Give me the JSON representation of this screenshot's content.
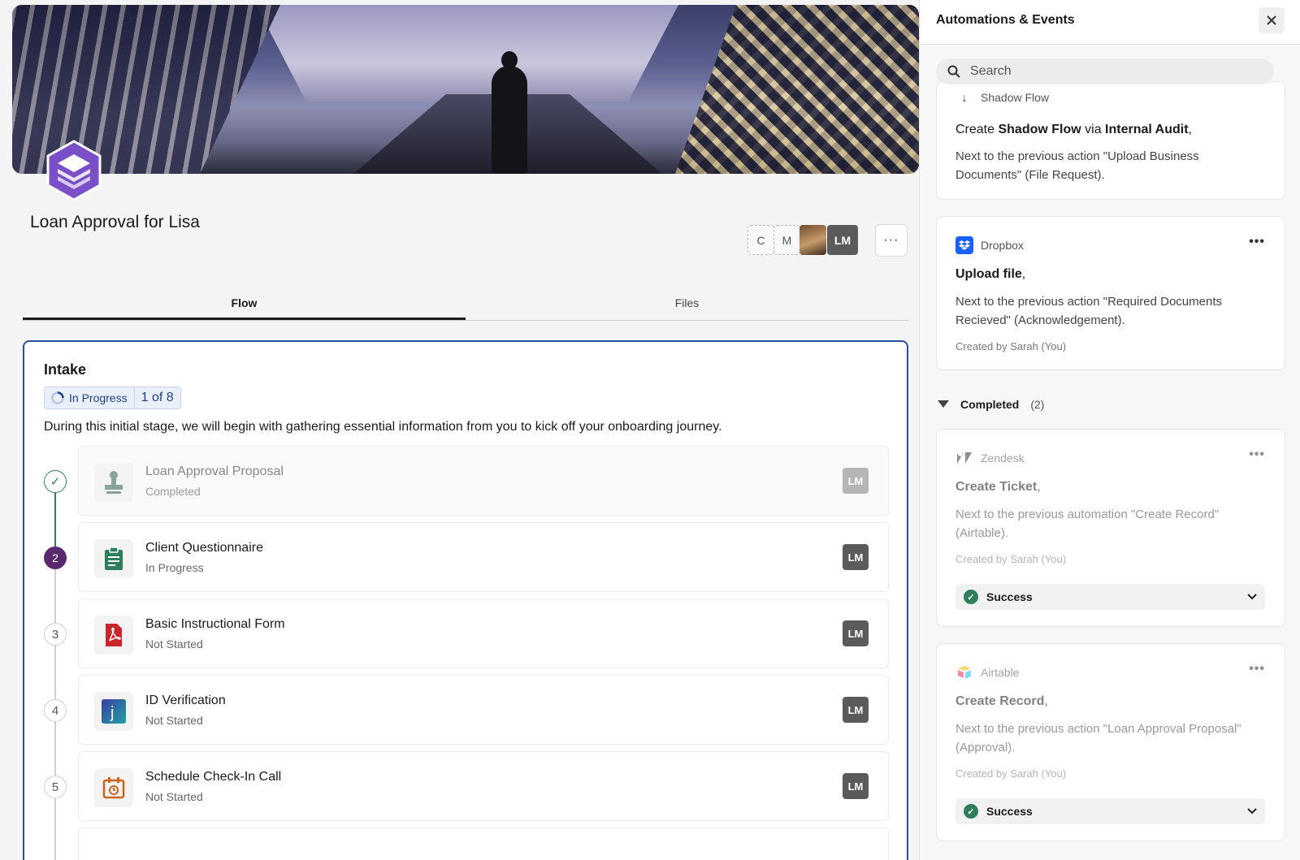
{
  "page": {
    "title": "Loan Approval for Lisa"
  },
  "assignees": [
    "C",
    "M",
    "LM"
  ],
  "header_more": "···",
  "tabs": [
    {
      "label": "Flow",
      "active": true
    },
    {
      "label": "Files",
      "active": false
    }
  ],
  "stage": {
    "title": "Intake",
    "status": "In Progress",
    "count": "1 of 8",
    "description": "During this initial stage, we will begin with gathering essential information from you to kick off your onboarding journey."
  },
  "steps": [
    {
      "marker": "✓",
      "name": "Loan Approval Proposal",
      "status": "Completed",
      "owner": "LM",
      "icon": "stamp-icon"
    },
    {
      "marker": "2",
      "name": "Client Questionnaire",
      "status": "In Progress",
      "owner": "LM",
      "icon": "clipboard-icon"
    },
    {
      "marker": "3",
      "name": "Basic Instructional Form",
      "status": "Not Started",
      "owner": "LM",
      "icon": "pdf-icon"
    },
    {
      "marker": "4",
      "name": "ID Verification",
      "status": "Not Started",
      "owner": "LM",
      "icon": "jumio-icon"
    },
    {
      "marker": "5",
      "name": "Schedule Check-In Call",
      "status": "Not Started",
      "owner": "LM",
      "icon": "calendar-icon"
    }
  ],
  "panel": {
    "title": "Automations & Events",
    "search_placeholder": "Search",
    "partial_card": {
      "app": "Shadow Flow",
      "action_prefix": "Create ",
      "action_bold1": "Shadow Flow",
      "action_mid": " via ",
      "action_bold2": "Internal Audit",
      "action_suffix": ",",
      "desc": "Next to the previous action \"Upload Business Documents\" (File Request)."
    },
    "pending_card": {
      "app": "Dropbox",
      "action": "Upload file",
      "action_suffix": ",",
      "desc": "Next to the previous action \"Required Documents Recieved\" (Acknowledgement).",
      "created": "Created by Sarah (You)"
    },
    "completed_label": "Completed",
    "completed_count": "(2)",
    "completed_cards": [
      {
        "app": "Zendesk",
        "action": "Create Ticket",
        "action_suffix": ",",
        "desc": "Next to the previous automation \"Create Record\" (Airtable).",
        "created": "Created by Sarah (You)",
        "result": "Success"
      },
      {
        "app": "Airtable",
        "action": "Create Record",
        "action_suffix": ",",
        "desc": "Next to the previous action \"Loan Approval Proposal\" (Approval).",
        "created": "Created by Sarah (You)",
        "result": "Success"
      }
    ]
  }
}
